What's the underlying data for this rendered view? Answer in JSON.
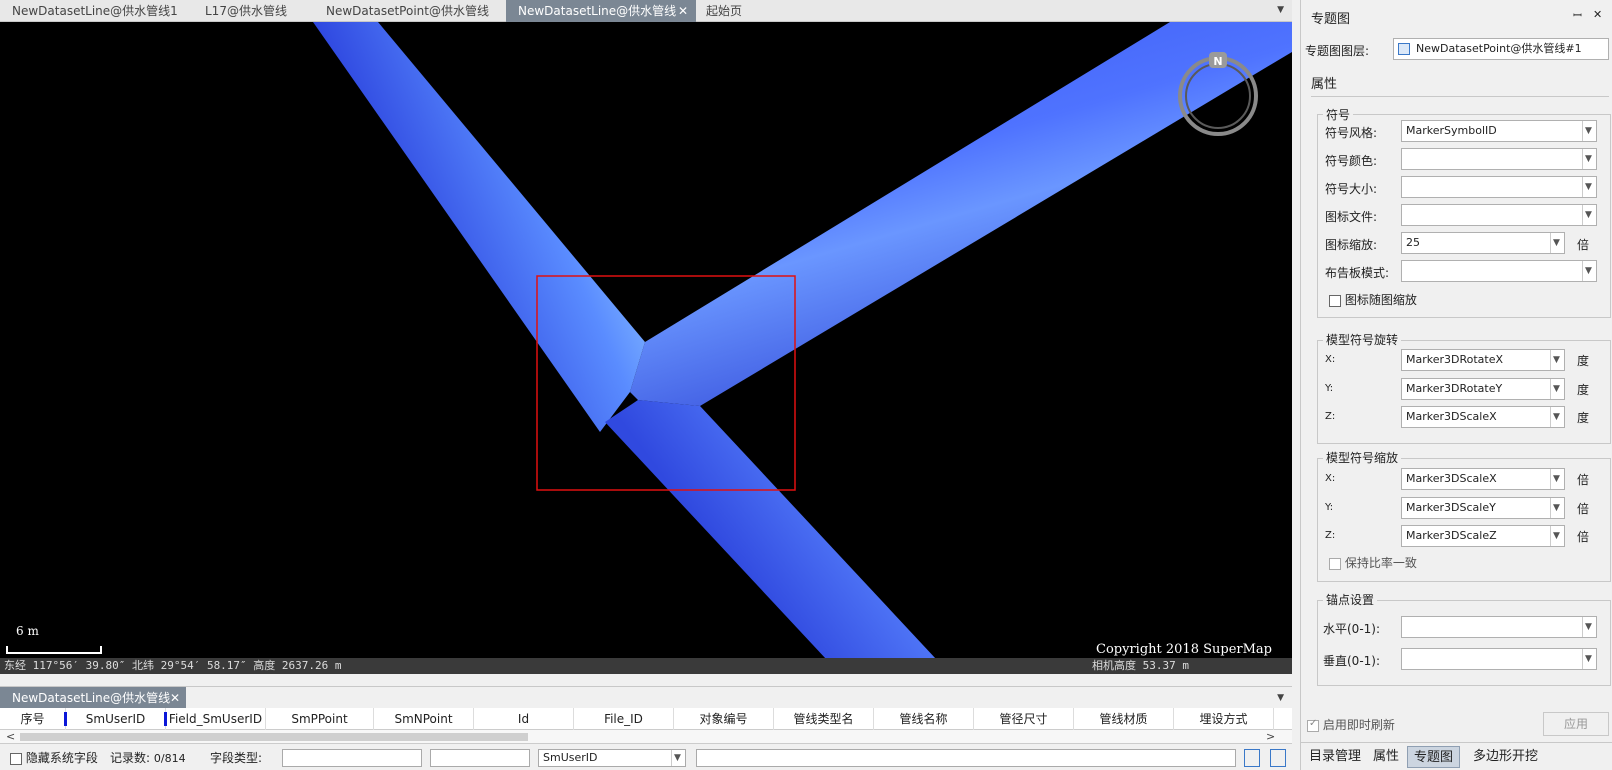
{
  "doc_tabs": [
    {
      "label": "NewDatasetLine@供水管线1",
      "active": false
    },
    {
      "label": "L17@供水管线",
      "active": false
    },
    {
      "label": "NewDatasetPoint@供水管线",
      "active": false
    },
    {
      "label": "NewDatasetLine@供水管线",
      "active": true
    },
    {
      "label": "起始页",
      "active": false
    }
  ],
  "doc_tab_close": "✕",
  "doc_tabs_dropdown": "▼",
  "scene": {
    "scale_label": "6 m",
    "copyright": "Copyright 2018 SuperMap",
    "coords": "东经 117°56′ 39.80″  北纬 29°54′ 58.17″  高度 2637.26 m",
    "camera_height": "相机高度 53.37 m",
    "compass_letter": "N",
    "pipe_color": "#3b5bff",
    "selection_color": "#e01010"
  },
  "attr_table": {
    "tab_label": "NewDatasetLine@供水管线",
    "tab_close": "✕",
    "dropdown": "▼",
    "columns": [
      "序号",
      "SmUserID",
      "Field_SmUserID",
      "SmPPoint",
      "SmNPoint",
      "Id",
      "File_ID",
      "对象编号",
      "管线类型名",
      "管线名称",
      "管径尺寸",
      "管线材质",
      "埋设方式"
    ],
    "scroll_left": "<",
    "scroll_right": ">",
    "toolbar": {
      "hide_system_fields": "隐藏系统字段",
      "record_count_label": "记录数:",
      "record_count": "0/814",
      "field_type_label": "字段类型:",
      "field_select": "SmUserID"
    }
  },
  "right_panel": {
    "title": "专题图",
    "pin": "ꟷ",
    "close": "✕",
    "layer_label": "专题图图层:",
    "layer_value": "NewDatasetPoint@供水管线#1",
    "properties_tab": "属性",
    "symbol_group": {
      "title": "符号",
      "fields": [
        {
          "label": "符号风格:",
          "value": ""
        },
        {
          "label": "符号颜色:",
          "value": ""
        },
        {
          "label": "符号大小:",
          "value": ""
        },
        {
          "label": "图标文件:",
          "value": ""
        },
        {
          "label": "图标缩放:",
          "value": "25",
          "unit": "倍"
        },
        {
          "label": "布告板模式:",
          "value": ""
        }
      ],
      "symbol_style_value": "MarkerSymbolID",
      "icon_scale_with_map": "图标随图缩放"
    },
    "rotate_group": {
      "title": "模型符号旋转",
      "fields": [
        {
          "label": "X:",
          "value": "Marker3DRotateX",
          "unit": "度"
        },
        {
          "label": "Y:",
          "value": "Marker3DRotateY",
          "unit": "度"
        },
        {
          "label": "Z:",
          "value": "Marker3DScaleX",
          "unit": "度"
        }
      ]
    },
    "scale_group": {
      "title": "模型符号缩放",
      "fields": [
        {
          "label": "X:",
          "value": "Marker3DScaleX",
          "unit": "倍"
        },
        {
          "label": "Y:",
          "value": "Marker3DScaleY",
          "unit": "倍"
        },
        {
          "label": "Z:",
          "value": "Marker3DScaleZ",
          "unit": "倍"
        }
      ],
      "keep_ratio": "保持比率一致"
    },
    "anchor_group": {
      "title": "锚点设置",
      "horizontal_label": "水平(0-1):",
      "horizontal_value": "",
      "vertical_label": "垂直(0-1):",
      "vertical_value": ""
    },
    "realtime_refresh": "启用即时刷新",
    "apply_button": "应用",
    "bottom_tabs": [
      {
        "label": "目录管理",
        "active": false
      },
      {
        "label": "属性",
        "active": false
      },
      {
        "label": "专题图",
        "active": true
      },
      {
        "label": "多边形开挖",
        "active": false
      }
    ]
  }
}
